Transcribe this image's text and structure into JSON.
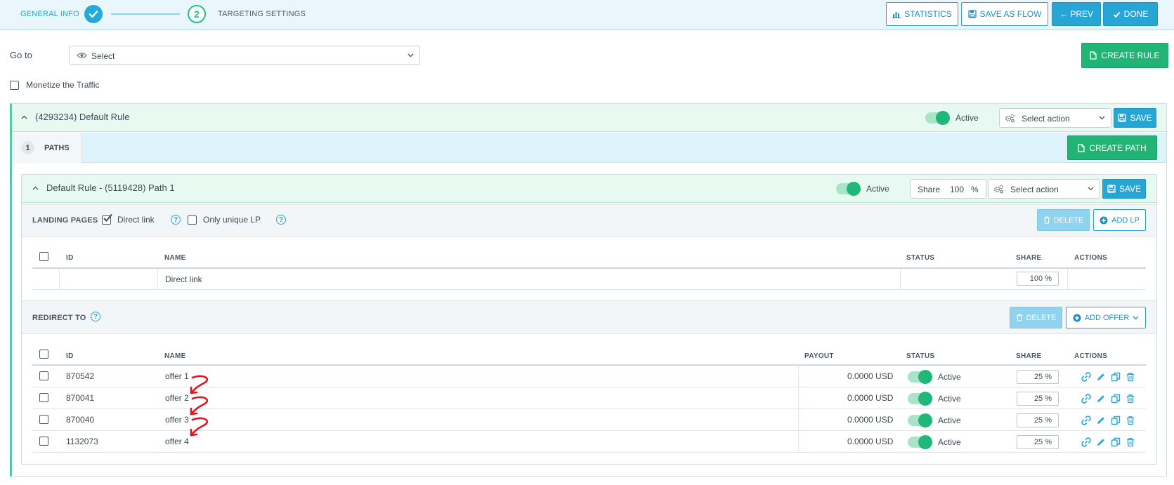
{
  "header": {
    "step1_label": "GENERAL INFO",
    "step2_number": "2",
    "step2_label": "TARGETING SETTINGS",
    "buttons": {
      "statistics": "STATISTICS",
      "save_as_flow": "SAVE AS FLOW",
      "prev": "← PREV",
      "done": "DONE"
    }
  },
  "goto": {
    "label": "Go to",
    "select_value": "Select",
    "create_rule": "CREATE RULE"
  },
  "monetize": {
    "label": "Monetize the Traffic",
    "checked": false
  },
  "rule": {
    "title": "(4293234) Default Rule",
    "status": "Active",
    "select_action": "Select action",
    "save": "SAVE",
    "paths_count": "1",
    "paths_tab": "PATHS",
    "create_path": "CREATE PATH"
  },
  "path": {
    "title": "Default Rule - (5119428) Path 1",
    "status": "Active",
    "share_label": "Share",
    "share_value": "100",
    "share_unit": "%",
    "select_action": "Select action",
    "save": "SAVE"
  },
  "landing_pages": {
    "label": "LANDING PAGES",
    "direct_link_label": "Direct link",
    "direct_link_checked": true,
    "only_unique_label": "Only unique LP",
    "only_unique_checked": false,
    "help_glyph": "?",
    "delete": "DELETE",
    "add_lp": "ADD LP",
    "columns": {
      "id": "ID",
      "name": "NAME",
      "status": "STATUS",
      "share": "SHARE",
      "actions": "ACTIONS"
    },
    "rows": [
      {
        "id": "",
        "name": "Direct link",
        "status": "",
        "share": "100 %"
      }
    ]
  },
  "redirect": {
    "label": "REDIRECT TO",
    "help_glyph": "?",
    "delete": "DELETE",
    "add_offer": "ADD OFFER",
    "columns": {
      "id": "ID",
      "name": "NAME",
      "payout": "PAYOUT",
      "status": "STATUS",
      "share": "SHARE",
      "actions": "ACTIONS"
    },
    "rows": [
      {
        "id": "870542",
        "name": "offer 1",
        "payout": "0.0000 USD",
        "status": "Active",
        "share": "25 %"
      },
      {
        "id": "870041",
        "name": "offer 2",
        "payout": "0.0000 USD",
        "status": "Active",
        "share": "25 %"
      },
      {
        "id": "870040",
        "name": "offer 3",
        "payout": "0.0000 USD",
        "status": "Active",
        "share": "25 %"
      },
      {
        "id": "1132073",
        "name": "offer 4",
        "payout": "0.0000 USD",
        "status": "Active",
        "share": "25 %"
      }
    ]
  },
  "row_actions": [
    "link-icon",
    "pencil-icon",
    "copy-icon",
    "trash-icon"
  ],
  "colors": {
    "accent_blue": "#27a6d6",
    "accent_green": "#20b574",
    "annotation_red": "#e4121b"
  }
}
